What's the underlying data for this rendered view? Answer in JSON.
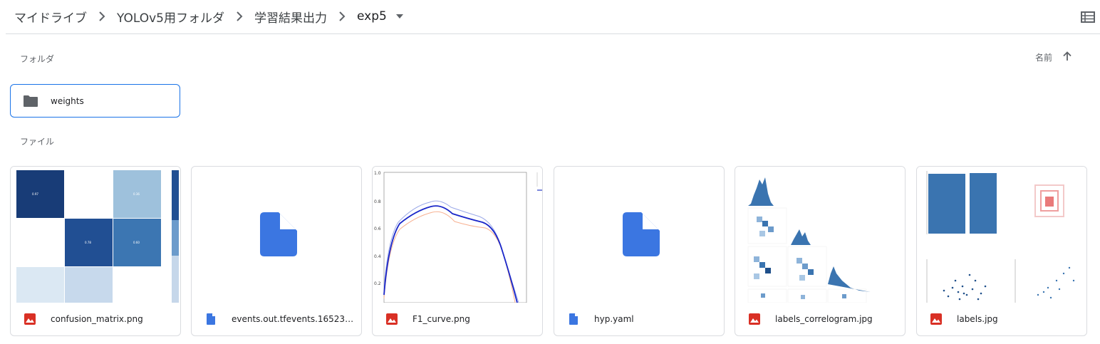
{
  "breadcrumb": {
    "items": [
      "マイドライブ",
      "YOLOv5用フォルダ",
      "学習結果出力",
      "exp5"
    ]
  },
  "sections": {
    "folders_label": "フォルダ",
    "files_label": "ファイル"
  },
  "sort": {
    "label": "名前",
    "direction": "ascending"
  },
  "folders": [
    {
      "name": "weights",
      "icon": "folder-icon"
    }
  ],
  "files": [
    {
      "name": "confusion_matrix.png",
      "icon": "image-file-icon"
    },
    {
      "name": "events.out.tfevents.165230…",
      "icon": "document-file-icon"
    },
    {
      "name": "F1_curve.png",
      "icon": "image-file-icon"
    },
    {
      "name": "hyp.yaml",
      "icon": "document-file-icon"
    },
    {
      "name": "labels_correlogram.jpg",
      "icon": "image-file-icon"
    },
    {
      "name": "labels.jpg",
      "icon": "image-file-icon"
    }
  ],
  "colors": {
    "accent": "#1a73e8",
    "doc_blue": "#4285f4",
    "image_red": "#d93025",
    "chart_blue": "#3a74b0"
  }
}
